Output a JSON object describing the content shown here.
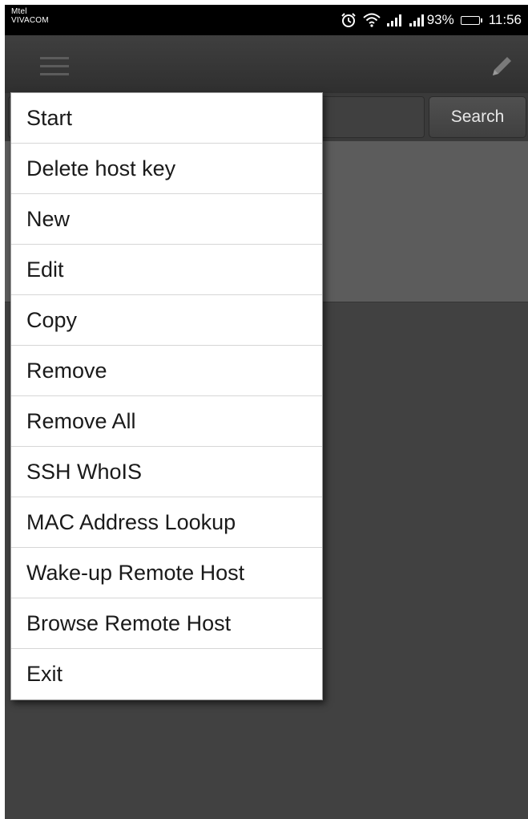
{
  "status_bar": {
    "carrier_1": "Mtel",
    "carrier_2": "VIVACOM",
    "battery": "93%",
    "time": "11:56",
    "battery_level": 0.93
  },
  "search": {
    "input_value": "",
    "button_label": "Search"
  },
  "menu": {
    "items": [
      {
        "label": "Start"
      },
      {
        "label": "Delete host key"
      },
      {
        "label": "New"
      },
      {
        "label": "Edit"
      },
      {
        "label": "Copy"
      },
      {
        "label": "Remove"
      },
      {
        "label": "Remove All"
      },
      {
        "label": "SSH WhoIS"
      },
      {
        "label": "MAC Address Lookup"
      },
      {
        "label": "Wake-up Remote Host"
      },
      {
        "label": "Browse Remote Host"
      },
      {
        "label": "Exit"
      }
    ]
  },
  "colors": {
    "background": "#414141",
    "status_bar": "#000000",
    "panel": "#5c5c5c",
    "menu_bg": "#ffffff"
  },
  "icons": [
    "alarm-icon",
    "wifi-icon",
    "signal-icon",
    "battery-icon",
    "hamburger-menu-icon",
    "edit-pencil-icon"
  ]
}
